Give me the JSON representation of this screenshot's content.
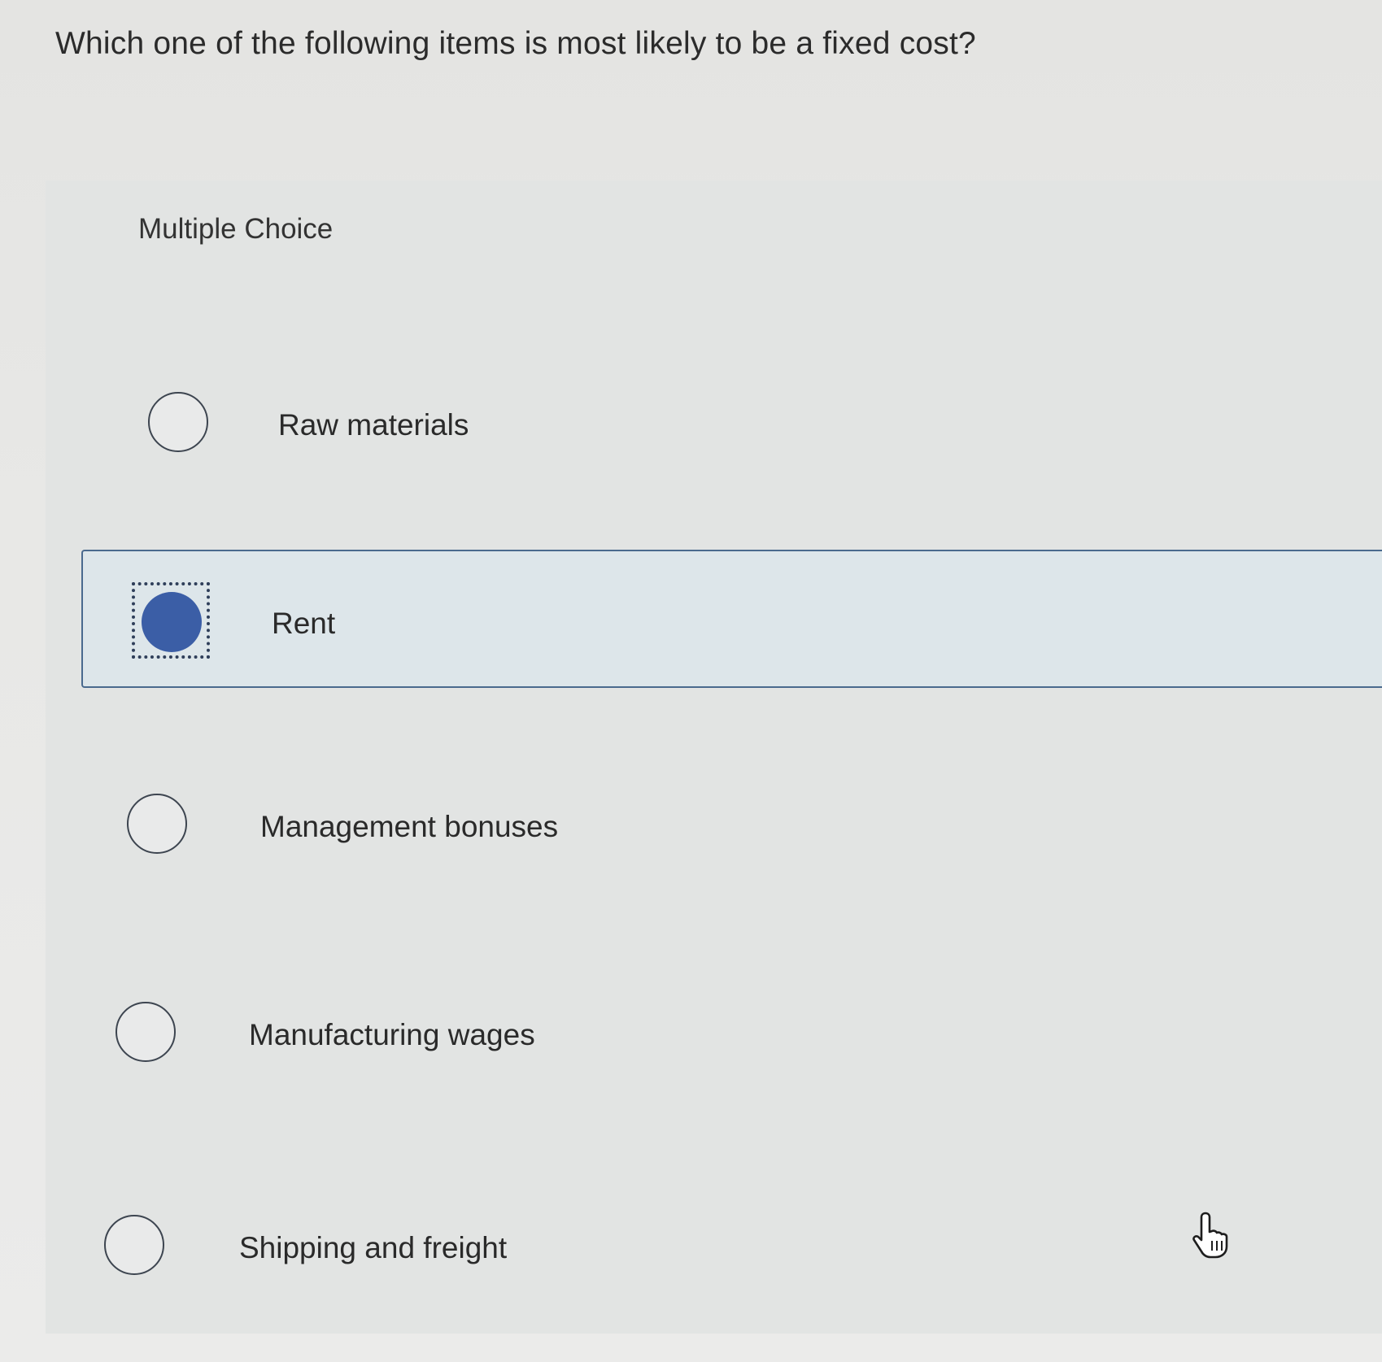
{
  "question": {
    "text": "Which one of the following items is most likely to be a fixed cost?"
  },
  "panel": {
    "label": "Multiple Choice"
  },
  "choices": [
    {
      "label": "Raw materials",
      "selected": false
    },
    {
      "label": "Rent",
      "selected": true
    },
    {
      "label": "Management bonuses",
      "selected": false
    },
    {
      "label": "Manufacturing wages",
      "selected": false
    },
    {
      "label": "Shipping and freight",
      "selected": false
    }
  ],
  "colors": {
    "accent": "#3b5ea6",
    "selected_background": "#dde6ea",
    "selected_border": "#4a6a8e"
  },
  "icons": {
    "cursor": "hand-pointer-icon"
  }
}
